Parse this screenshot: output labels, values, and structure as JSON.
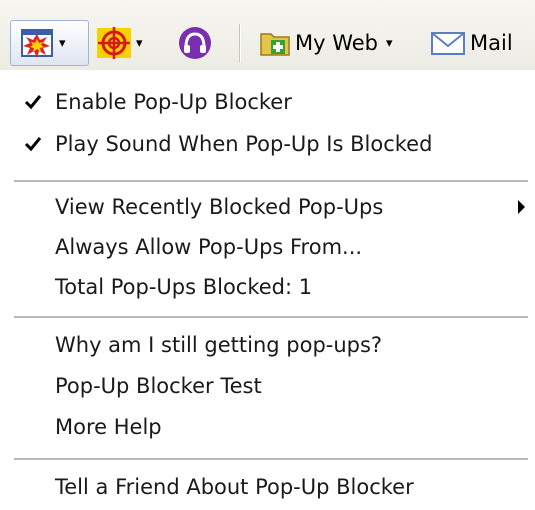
{
  "toolbar": {
    "popup_blocker_icon": "popup-blocker-burst-icon",
    "target_icon": "crosshair-target-icon",
    "headphones_icon": "headphones-icon",
    "my_web_label": "My Web",
    "mail_label": "Mail",
    "dropdown_glyph": "▾"
  },
  "menu": {
    "check_glyph": "✔",
    "items": [
      {
        "label": "Enable Pop-Up Blocker",
        "checked": true
      },
      {
        "label": "Play Sound When Pop-Up Is Blocked",
        "checked": true
      },
      {
        "label": "View Recently Blocked Pop-Ups",
        "submenu": true
      },
      {
        "label": "Always Allow Pop-Ups From..."
      },
      {
        "label": "Total Pop-Ups Blocked: 1"
      },
      {
        "label": "Why am I still getting pop-ups?"
      },
      {
        "label": "Pop-Up Blocker Test"
      },
      {
        "label": "More Help"
      },
      {
        "label": "Tell a Friend About Pop-Up Blocker"
      }
    ]
  },
  "colors": {
    "popup_icon_red": "#e02020",
    "popup_icon_yellow": "#f7d200",
    "headphones_purple": "#7a2fb0",
    "folder_yellow": "#e8c34a",
    "plus_green": "#2fa72f",
    "mail_blue": "#5b7fc4"
  }
}
